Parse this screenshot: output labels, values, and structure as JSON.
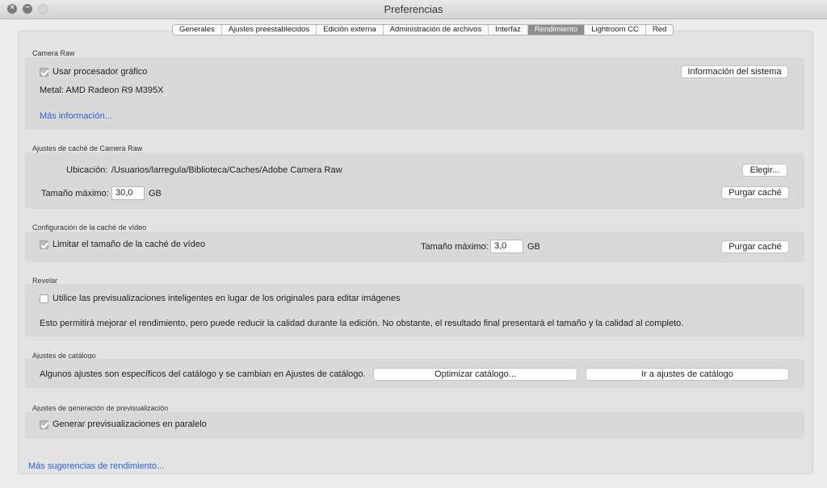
{
  "window": {
    "title": "Preferencias"
  },
  "tabs": [
    {
      "label": "Generales"
    },
    {
      "label": "Ajustes preestablecidos"
    },
    {
      "label": "Edición externa"
    },
    {
      "label": "Administración de archivos"
    },
    {
      "label": "Interfaz"
    },
    {
      "label": "Rendimiento",
      "active": true
    },
    {
      "label": "Lightroom CC"
    },
    {
      "label": "Red"
    }
  ],
  "camera_raw": {
    "title": "Camera Raw",
    "use_gpu_label": "Usar procesador gráfico",
    "use_gpu_checked": true,
    "system_info_button": "Información del sistema",
    "metal_text": "Metal: AMD Radeon R9 M395X",
    "more_info_link": "Más información..."
  },
  "cache": {
    "title": "Ajustes de caché de Camera Raw",
    "location_label": "Ubicación:",
    "location_value": "/Usuarios/larregula/Biblioteca/Caches/Adobe Camera Raw",
    "choose_button": "Elegir...",
    "max_size_label": "Tamaño máximo:",
    "max_size_value": "30,0",
    "unit": "GB",
    "purge_button": "Purgar caché"
  },
  "video_cache": {
    "title": "Configuración de la caché de vídeo",
    "limit_label": "Limitar el tamaño de la caché de vídeo",
    "limit_checked": true,
    "max_size_label": "Tamaño máximo:",
    "max_size_value": "3,0",
    "unit": "GB",
    "purge_button": "Purgar caché"
  },
  "develop": {
    "title": "Revelar",
    "smart_previews_label": "Utilice las previsualizaciones inteligentes en lugar de los originales para editar imágenes",
    "smart_previews_checked": false,
    "description": "Esto permitirá mejorar el rendimiento, pero puede reducir la calidad durante la edición. No obstante, el resultado final presentará el tamaño y la calidad al completo."
  },
  "catalog": {
    "title": "Ajustes de catálogo",
    "description": "Algunos ajustes son específicos del catálogo y se cambian en Ajustes de catálogo.",
    "optimize_button": "Optimizar catálogo...",
    "goto_button": "Ir a ajustes de catálogo"
  },
  "preview_generation": {
    "title": "Ajustes de generación de previsualización",
    "parallel_label": "Generar previsualizaciones en paralelo",
    "parallel_checked": true
  },
  "footer": {
    "more_tips_link": "Más sugerencias de rendimiento..."
  }
}
